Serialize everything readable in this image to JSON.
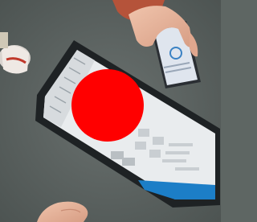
{
  "scene": {
    "table_color": "#5e6663",
    "tablet": {
      "bezel_color": "#1e2224",
      "screen_color": "#e9ecee",
      "sidebar_color": "#d7dbde",
      "accent_color": "#1c7ec7"
    },
    "phone": {
      "bezel_color": "#2a2e33",
      "screen_color": "#dfe5ee",
      "accent_color": "#3b82c4"
    },
    "redaction_circle": {
      "color": "#ff0000"
    },
    "skin_color": "#e7b79e",
    "sleeve_color": "#b5533a"
  }
}
